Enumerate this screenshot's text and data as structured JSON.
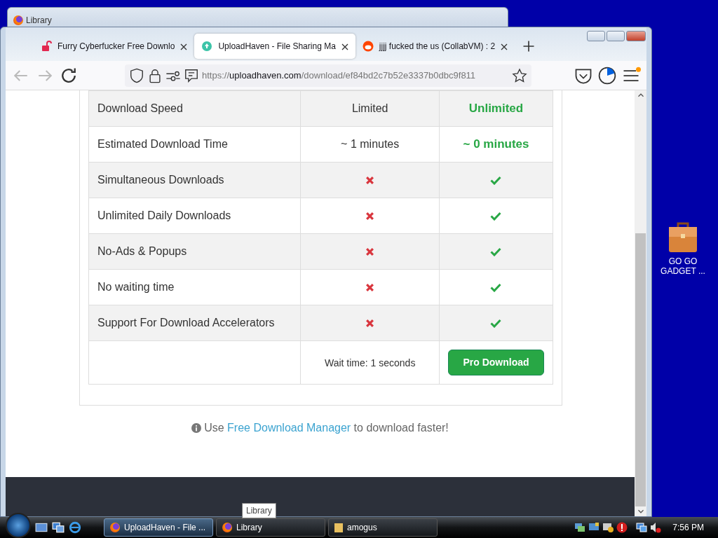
{
  "back_window": {
    "title": "Library"
  },
  "tabs": [
    {
      "label": "Furry Cyberfucker Free Downlo",
      "selected": false
    },
    {
      "label": "UploadHaven - File Sharing Ma",
      "selected": true
    },
    {
      "label": "jjjj fucked the us (CollabVM) : 2",
      "selected": false
    }
  ],
  "url": {
    "host": "uploadhaven.com",
    "scheme": "https://",
    "path": "/download/ef84bd2c7b52e3337b0dbc9f811"
  },
  "table": {
    "rows": [
      {
        "feature": "Download Speed",
        "free": {
          "kind": "text",
          "text": "Limited"
        },
        "pro": {
          "kind": "text",
          "text": "Unlimited"
        }
      },
      {
        "feature": "Estimated Download Time",
        "free": {
          "kind": "text",
          "text": "~ 1 minutes"
        },
        "pro": {
          "kind": "text",
          "text": "~ 0 minutes"
        }
      },
      {
        "feature": "Simultaneous Downloads",
        "free": {
          "kind": "no"
        },
        "pro": {
          "kind": "yes"
        }
      },
      {
        "feature": "Unlimited Daily Downloads",
        "free": {
          "kind": "no"
        },
        "pro": {
          "kind": "yes"
        }
      },
      {
        "feature": "No-Ads & Popups",
        "free": {
          "kind": "no"
        },
        "pro": {
          "kind": "yes"
        }
      },
      {
        "feature": "No waiting time",
        "free": {
          "kind": "no"
        },
        "pro": {
          "kind": "yes"
        }
      },
      {
        "feature": "Support For Download Accelerators",
        "free": {
          "kind": "no"
        },
        "pro": {
          "kind": "yes"
        }
      }
    ],
    "wait_text": "Wait time: 1 seconds",
    "pro_button": "Pro Download"
  },
  "note": {
    "before": "Use",
    "link": "Free Download Manager",
    "after": "to download faster!"
  },
  "desktop_icon": {
    "label": "GO GO\nGADGET ..."
  },
  "tooltip": "Library",
  "taskbar": {
    "items": [
      {
        "label": "UploadHaven - File ...",
        "selected": true
      },
      {
        "label": "Library",
        "selected": false
      },
      {
        "label": "amogus",
        "selected": false
      }
    ],
    "clock": "7:56 PM"
  }
}
